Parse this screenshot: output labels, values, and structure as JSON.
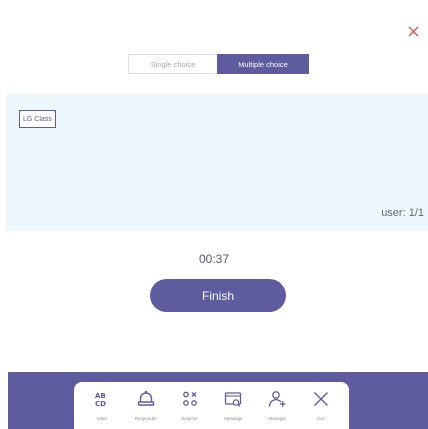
{
  "colors": {
    "accent": "#5e5b9e",
    "panel_bg": "#eef7fb",
    "close": "#e05555"
  },
  "mode_toggle": {
    "single_label": "Single choice",
    "multiple_label": "Multiple choice",
    "selected": "multiple"
  },
  "panel": {
    "class_tag": "LG Class",
    "user_count": "user: 1/1"
  },
  "timer": "00:37",
  "finish_label": "Finish",
  "toolbar": {
    "items": [
      {
        "label": "Voter",
        "icon": "voter-icon"
      },
      {
        "label": "Responder",
        "icon": "bell-icon"
      },
      {
        "label": "Selector",
        "icon": "selector-icon"
      },
      {
        "label": "Message",
        "icon": "message-icon"
      },
      {
        "label": "Manager",
        "icon": "manager-icon"
      },
      {
        "label": "Exit",
        "icon": "close-icon"
      }
    ]
  }
}
